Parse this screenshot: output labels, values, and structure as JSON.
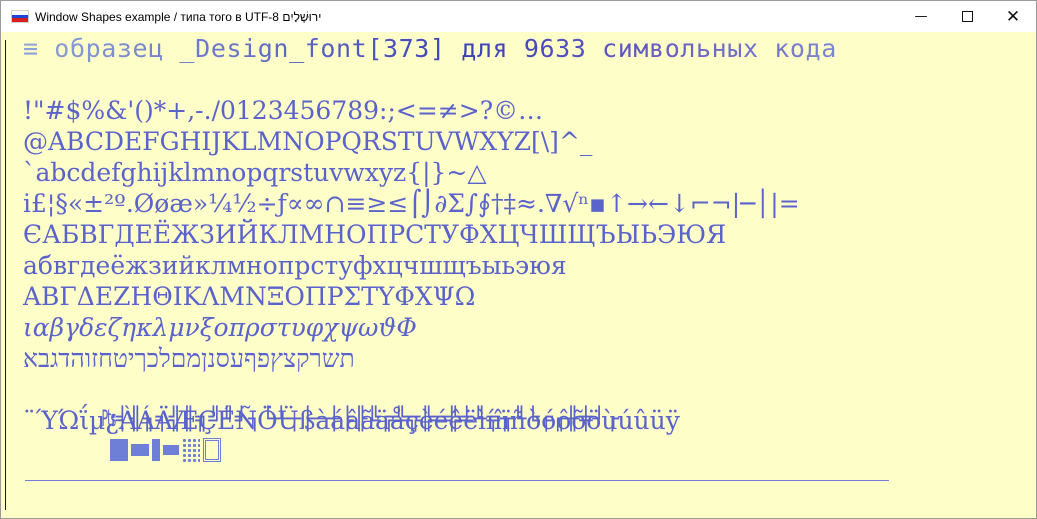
{
  "window": {
    "title": "Window Shapes example / типа того в UTF-8 ירוּשָׁלַיִם",
    "flag_colors": [
      "#ffffff",
      "#1a47d8",
      "#d81e1e"
    ],
    "controls": {
      "minimize": "—",
      "maximize": "",
      "close": "✕"
    },
    "background": "#fefec8",
    "text_color": "#5a62cc"
  },
  "content": {
    "header": "≡ образец _Design_font[373] для 9633 символьных кода",
    "lines": [
      "!\"#$%&'()*+,-./0123456789:;<=≠>?©…",
      "@ABCDEFGHIJKLMNOPQRSTUVWXYZ[\\]^_",
      "`abcdefghijklmnopqrstuvwxyz{|}~△",
      "i£¦§«±²º.Øøæ»¼½÷ƒ∝∞∩≡≥≤⌠⌡∂Σ∫∮†‡≈.∇√ⁿ▪↑→←↓⌐¬|─│|=",
      "ЄАБВГДЕЁЖЗИЙКЛМНОПРСТУФХЦЧШЩЪЫЬЭЮЯ",
      "абвгдеёжзийклмнопрстуфхцчшщъыьэюя",
      "ΑΒΓΔΕΖΗΘΙΚΛΜΝΞΟΠΡΣΤΥΦΧΨΩ",
      "ιαβγδεζηκλμνξοπρστυφχψωϑΦ",
      "תשרקצץפףעסנןמםלכךיטחזוהדגבא",
      "₧╡╢╖╕╣║╗╝╜╛┐└┴┬├─┼╞╟╚╔╩╦╠═╬╧╨╤╥╙╘╒╓╫╪┘┌",
      "¨ΎΏΐµ¿ÀÁÄÆÇÉÑÖÜßàáâãäåçèéêëìíîïñòóôõöùúûüÿ",
      "____________________________________________________________"
    ]
  }
}
